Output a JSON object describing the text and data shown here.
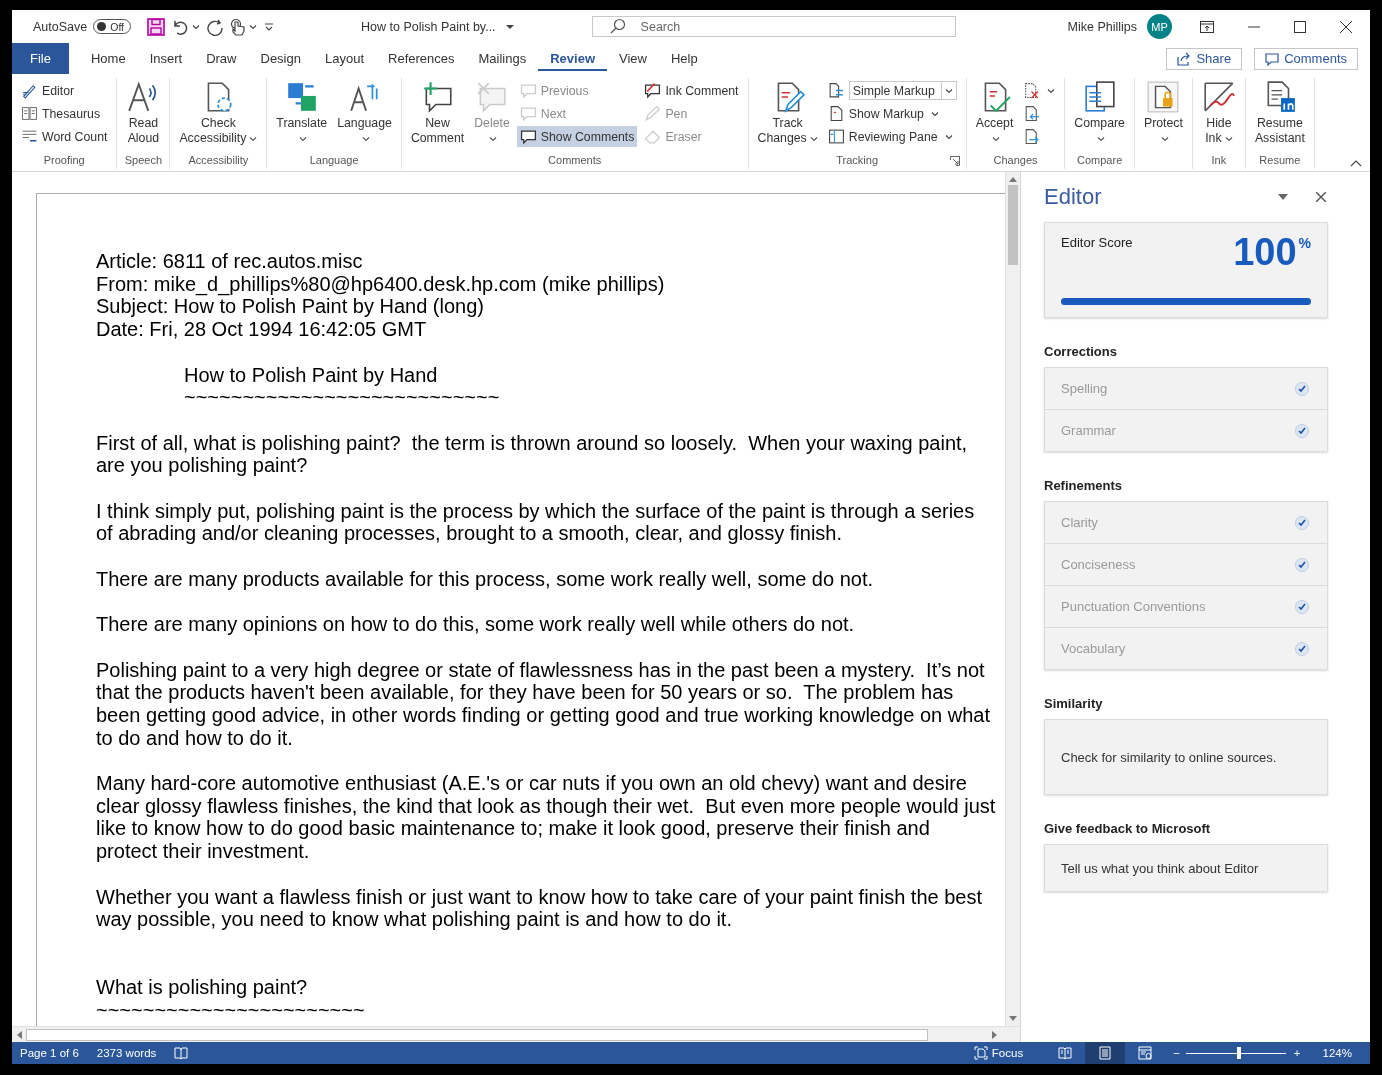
{
  "title_bar": {
    "autosave": {
      "label": "AutoSave",
      "on": false,
      "state_text": "Off"
    },
    "document_title": "How to Polish Paint by...",
    "search": {
      "placeholder": "Search"
    },
    "user": {
      "name": "Mike Phillips",
      "initials": "MP"
    }
  },
  "ribbon_tabs": [
    {
      "label": "File",
      "kind": "file",
      "selected": false
    },
    {
      "label": "Home",
      "kind": "tab",
      "selected": false
    },
    {
      "label": "Insert",
      "kind": "tab",
      "selected": false
    },
    {
      "label": "Draw",
      "kind": "tab",
      "selected": false
    },
    {
      "label": "Design",
      "kind": "tab",
      "selected": false
    },
    {
      "label": "Layout",
      "kind": "tab",
      "selected": false
    },
    {
      "label": "References",
      "kind": "tab",
      "selected": false
    },
    {
      "label": "Mailings",
      "kind": "tab",
      "selected": false
    },
    {
      "label": "Review",
      "kind": "tab",
      "selected": true
    },
    {
      "label": "View",
      "kind": "tab",
      "selected": false
    },
    {
      "label": "Help",
      "kind": "tab",
      "selected": false
    }
  ],
  "ribbon_actions": [
    {
      "label": "Share"
    },
    {
      "label": "Comments"
    }
  ],
  "ribbon_groups": [
    {
      "label": "Proofing",
      "columns": [
        {
          "kind": "small",
          "items": [
            {
              "label": "Editor",
              "disabled": false,
              "selected": false,
              "dropdown": false
            },
            {
              "label": "Thesaurus",
              "disabled": false,
              "selected": false,
              "dropdown": false
            },
            {
              "label": "Word Count",
              "disabled": false,
              "selected": false,
              "dropdown": false
            }
          ]
        }
      ]
    },
    {
      "label": "Speech",
      "columns": [
        {
          "kind": "large",
          "items": [
            {
              "label": "Read Aloud",
              "disabled": false,
              "selected": false,
              "dropdown": false
            }
          ]
        }
      ]
    },
    {
      "label": "Accessibility",
      "columns": [
        {
          "kind": "large",
          "items": [
            {
              "label": "Check Accessibility",
              "disabled": false,
              "selected": false,
              "dropdown": true
            }
          ]
        }
      ]
    },
    {
      "label": "Language",
      "columns": [
        {
          "kind": "large",
          "items": [
            {
              "label": "Translate",
              "disabled": false,
              "selected": false,
              "dropdown": true
            }
          ]
        },
        {
          "kind": "large",
          "items": [
            {
              "label": "Language",
              "disabled": false,
              "selected": false,
              "dropdown": true
            }
          ]
        }
      ]
    },
    {
      "label": "Comments",
      "columns": [
        {
          "kind": "large",
          "items": [
            {
              "label": "New Comment",
              "disabled": false,
              "selected": false,
              "dropdown": false
            }
          ]
        },
        {
          "kind": "large",
          "items": [
            {
              "label": "Delete",
              "disabled": true,
              "selected": false,
              "dropdown": true
            }
          ]
        },
        {
          "kind": "small",
          "items": [
            {
              "label": "Previous",
              "disabled": true,
              "selected": false,
              "dropdown": false
            },
            {
              "label": "Next",
              "disabled": true,
              "selected": false,
              "dropdown": false
            },
            {
              "label": "Show Comments",
              "disabled": false,
              "selected": true,
              "dropdown": false
            }
          ]
        },
        {
          "kind": "small",
          "items": [
            {
              "label": "Ink Comment",
              "disabled": false,
              "selected": false,
              "dropdown": false
            },
            {
              "label": "Pen",
              "disabled": true,
              "selected": false,
              "dropdown": false
            },
            {
              "label": "Eraser",
              "disabled": true,
              "selected": false,
              "dropdown": false
            }
          ]
        }
      ]
    },
    {
      "label": "Tracking",
      "launcher": true,
      "columns": [
        {
          "kind": "large",
          "items": [
            {
              "label": "Track Changes",
              "disabled": false,
              "selected": false,
              "dropdown": true
            }
          ]
        },
        {
          "kind": "small",
          "items": [
            {
              "kind": "select",
              "value": "Simple Markup",
              "disabled": false,
              "selected": false,
              "dropdown": true
            },
            {
              "label": "Show Markup",
              "disabled": false,
              "selected": false,
              "dropdown": true
            },
            {
              "label": "Reviewing Pane",
              "disabled": false,
              "selected": false,
              "dropdown": true
            }
          ]
        }
      ]
    },
    {
      "label": "Changes",
      "columns": [
        {
          "kind": "large",
          "items": [
            {
              "label": "Accept",
              "disabled": false,
              "selected": false,
              "dropdown": true
            }
          ]
        },
        {
          "kind": "small",
          "items": [
            {
              "disabled": false,
              "selected": false,
              "dropdown": true
            },
            {
              "disabled": false,
              "selected": false,
              "dropdown": false
            },
            {
              "disabled": false,
              "selected": false,
              "dropdown": false
            }
          ]
        }
      ]
    },
    {
      "label": "Compare",
      "columns": [
        {
          "kind": "large",
          "items": [
            {
              "label": "Compare",
              "disabled": false,
              "selected": false,
              "dropdown": true
            }
          ]
        }
      ]
    },
    {
      "columns": [
        {
          "kind": "large",
          "items": [
            {
              "label": "Protect",
              "disabled": false,
              "selected": false,
              "dropdown": true
            }
          ]
        }
      ]
    },
    {
      "label": "Ink",
      "columns": [
        {
          "kind": "large",
          "items": [
            {
              "label": "Hide Ink",
              "disabled": false,
              "selected": false,
              "dropdown": true
            }
          ]
        }
      ]
    },
    {
      "label": "Resume",
      "columns": [
        {
          "kind": "large",
          "items": [
            {
              "label": "Resume Assistant",
              "disabled": false,
              "selected": false,
              "dropdown": false
            }
          ]
        }
      ]
    }
  ],
  "document": {
    "paragraphs": [
      {
        "kind": "header",
        "lines": [
          "Article: 6811 of rec.autos.misc",
          "From: mike_d_phillips%80@hp6400.desk.hp.com (mike phillips)",
          "Subject: How to Polish Paint by Hand (long)",
          "Date: Fri, 28 Oct 1994 16:42:05 GMT"
        ]
      },
      {
        "kind": "title",
        "lines": [
          "How to Polish Paint by Hand",
          "~~~~~~~~~~~~~~~~~~~~~~~~~~~"
        ]
      },
      {
        "kind": "body",
        "lines": [
          "First of all, what is polishing paint?  the term is thrown around so loosely.  When your waxing paint,",
          "are you polishing paint?"
        ]
      },
      {
        "kind": "body",
        "lines": [
          "I think simply put, polishing paint is the process by which the surface of the paint is through a series",
          "of abrading and/or cleaning processes, brought to a smooth, clear, and glossy finish."
        ]
      },
      {
        "kind": "body",
        "lines": [
          "There are many products available for this process, some work really well, some do not."
        ]
      },
      {
        "kind": "body",
        "lines": [
          "There are many opinions on how to do this, some work really well while others do not."
        ]
      },
      {
        "kind": "body",
        "lines": [
          "Polishing paint to a very high degree or state of flawlessness has in the past been a mystery.  It’s not",
          "that the products haven't been available, for they have been for 50 years or so.  The problem has",
          "been getting good advice, in other words finding or getting good and true working knowledge on what",
          "to do and how to do it."
        ]
      },
      {
        "kind": "body",
        "lines": [
          "Many hard-core automotive enthusiast (A.E.'s or car nuts if you own an old chevy) want and desire",
          "clear glossy flawless finishes, the kind that look as though their wet.  But even more people would just",
          "like to know how to do good basic maintenance to; make it look good, preserve their finish and",
          "protect their investment."
        ]
      },
      {
        "kind": "body",
        "lines": [
          "Whether you want a flawless finish or just want to know how to take care of your paint finish the best",
          "way possible, you need to know what polishing paint is and how to do it."
        ]
      },
      {
        "kind": "heading",
        "lines": [
          "What is polishing paint?",
          "~~~~~~~~~~~~~~~~~~~~~~~"
        ]
      }
    ]
  },
  "editor_pane": {
    "title": "Editor",
    "score": {
      "label": "Editor Score",
      "value": "100",
      "unit": "%",
      "level": 1
    },
    "sections": [
      {
        "heading": "Corrections",
        "kind": "checklist",
        "items": [
          {
            "label": "Spelling",
            "checked": true
          },
          {
            "label": "Grammar",
            "checked": true
          }
        ]
      },
      {
        "heading": "Refinements",
        "kind": "checklist",
        "items": [
          {
            "label": "Clarity",
            "checked": true
          },
          {
            "label": "Conciseness",
            "checked": true
          },
          {
            "label": "Punctuation Conventions",
            "checked": true
          },
          {
            "label": "Vocabulary",
            "checked": true
          }
        ]
      },
      {
        "heading": "Similarity",
        "kind": "action",
        "text": "Check for similarity to online sources."
      },
      {
        "heading": "Give feedback to Microsoft",
        "kind": "action",
        "text": "Tell us what you think about Editor"
      }
    ]
  },
  "status_bar": {
    "page": "Page 1 of 6",
    "words": "2373 words",
    "focus": "Focus",
    "views": [
      {
        "kind": "read",
        "selected": false
      },
      {
        "kind": "print",
        "selected": true
      },
      {
        "kind": "web",
        "selected": false
      }
    ],
    "zoom": {
      "out": "−",
      "in": "+",
      "level": 0.53,
      "text": "124%"
    }
  }
}
